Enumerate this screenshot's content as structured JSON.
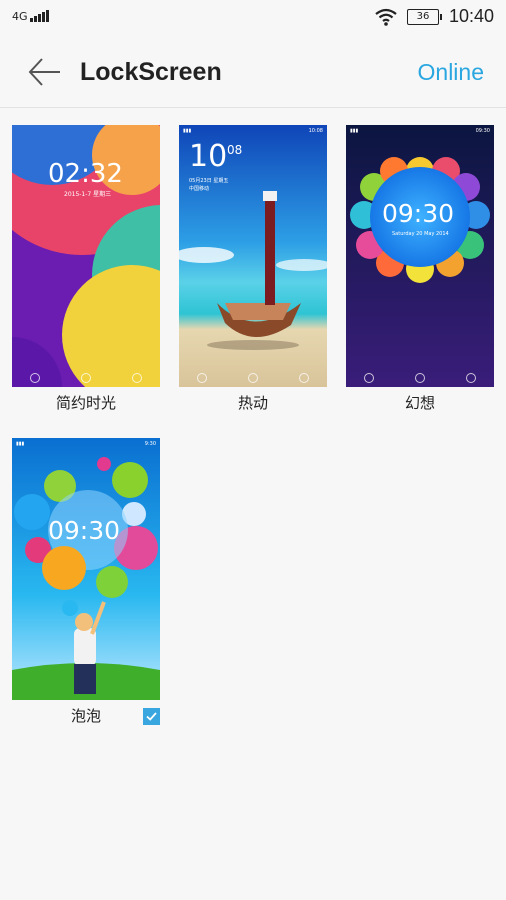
{
  "status": {
    "network": "4G",
    "battery": "36",
    "time": "10:40"
  },
  "header": {
    "title": "LockScreen",
    "online_label": "Online"
  },
  "themes": [
    {
      "name": "简约时光",
      "preview_time": "02:32",
      "preview_date": "2015-1-7  星期三",
      "selected": false
    },
    {
      "name": "热动",
      "preview_time": "10",
      "preview_minute": "08",
      "preview_date": "05月23日 星期五",
      "preview_sub": "中国移动",
      "selected": false
    },
    {
      "name": "幻想",
      "preview_time": "09:30",
      "preview_date": "Saturday 20 May 2014",
      "selected": false
    },
    {
      "name": "泡泡",
      "preview_time": "09:30",
      "selected": true
    }
  ],
  "colors": {
    "accent": "#2aa7e0",
    "check": "#3aa6e0"
  }
}
